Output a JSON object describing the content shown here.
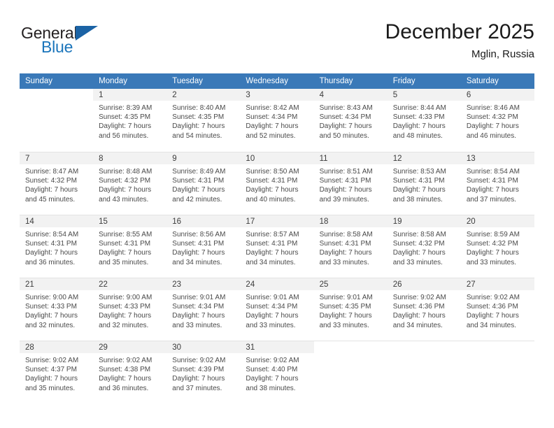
{
  "brand": {
    "name_top": "General",
    "name_bottom": "Blue",
    "triangle_icon": "triangle-icon",
    "color_dark": "#231f20",
    "color_blue": "#1b75bb"
  },
  "header": {
    "title": "December 2025",
    "subtitle": "Mglin, Russia"
  },
  "theme": {
    "header_row_bg": "#3a79b8",
    "daynum_band_bg": "#f2f2f2",
    "text_color": "#4a4a4a",
    "separator": "#e3e3e3"
  },
  "calendar": {
    "weekday_headers": [
      "Sunday",
      "Monday",
      "Tuesday",
      "Wednesday",
      "Thursday",
      "Friday",
      "Saturday"
    ],
    "weeks": [
      [
        {
          "day": "",
          "blank": true,
          "lines": []
        },
        {
          "day": "1",
          "lines": [
            "Sunrise: 8:39 AM",
            "Sunset: 4:35 PM",
            "Daylight: 7 hours",
            "and 56 minutes."
          ]
        },
        {
          "day": "2",
          "lines": [
            "Sunrise: 8:40 AM",
            "Sunset: 4:35 PM",
            "Daylight: 7 hours",
            "and 54 minutes."
          ]
        },
        {
          "day": "3",
          "lines": [
            "Sunrise: 8:42 AM",
            "Sunset: 4:34 PM",
            "Daylight: 7 hours",
            "and 52 minutes."
          ]
        },
        {
          "day": "4",
          "lines": [
            "Sunrise: 8:43 AM",
            "Sunset: 4:34 PM",
            "Daylight: 7 hours",
            "and 50 minutes."
          ]
        },
        {
          "day": "5",
          "lines": [
            "Sunrise: 8:44 AM",
            "Sunset: 4:33 PM",
            "Daylight: 7 hours",
            "and 48 minutes."
          ]
        },
        {
          "day": "6",
          "lines": [
            "Sunrise: 8:46 AM",
            "Sunset: 4:32 PM",
            "Daylight: 7 hours",
            "and 46 minutes."
          ]
        }
      ],
      [
        {
          "day": "7",
          "lines": [
            "Sunrise: 8:47 AM",
            "Sunset: 4:32 PM",
            "Daylight: 7 hours",
            "and 45 minutes."
          ]
        },
        {
          "day": "8",
          "lines": [
            "Sunrise: 8:48 AM",
            "Sunset: 4:32 PM",
            "Daylight: 7 hours",
            "and 43 minutes."
          ]
        },
        {
          "day": "9",
          "lines": [
            "Sunrise: 8:49 AM",
            "Sunset: 4:31 PM",
            "Daylight: 7 hours",
            "and 42 minutes."
          ]
        },
        {
          "day": "10",
          "lines": [
            "Sunrise: 8:50 AM",
            "Sunset: 4:31 PM",
            "Daylight: 7 hours",
            "and 40 minutes."
          ]
        },
        {
          "day": "11",
          "lines": [
            "Sunrise: 8:51 AM",
            "Sunset: 4:31 PM",
            "Daylight: 7 hours",
            "and 39 minutes."
          ]
        },
        {
          "day": "12",
          "lines": [
            "Sunrise: 8:53 AM",
            "Sunset: 4:31 PM",
            "Daylight: 7 hours",
            "and 38 minutes."
          ]
        },
        {
          "day": "13",
          "lines": [
            "Sunrise: 8:54 AM",
            "Sunset: 4:31 PM",
            "Daylight: 7 hours",
            "and 37 minutes."
          ]
        }
      ],
      [
        {
          "day": "14",
          "lines": [
            "Sunrise: 8:54 AM",
            "Sunset: 4:31 PM",
            "Daylight: 7 hours",
            "and 36 minutes."
          ]
        },
        {
          "day": "15",
          "lines": [
            "Sunrise: 8:55 AM",
            "Sunset: 4:31 PM",
            "Daylight: 7 hours",
            "and 35 minutes."
          ]
        },
        {
          "day": "16",
          "lines": [
            "Sunrise: 8:56 AM",
            "Sunset: 4:31 PM",
            "Daylight: 7 hours",
            "and 34 minutes."
          ]
        },
        {
          "day": "17",
          "lines": [
            "Sunrise: 8:57 AM",
            "Sunset: 4:31 PM",
            "Daylight: 7 hours",
            "and 34 minutes."
          ]
        },
        {
          "day": "18",
          "lines": [
            "Sunrise: 8:58 AM",
            "Sunset: 4:31 PM",
            "Daylight: 7 hours",
            "and 33 minutes."
          ]
        },
        {
          "day": "19",
          "lines": [
            "Sunrise: 8:58 AM",
            "Sunset: 4:32 PM",
            "Daylight: 7 hours",
            "and 33 minutes."
          ]
        },
        {
          "day": "20",
          "lines": [
            "Sunrise: 8:59 AM",
            "Sunset: 4:32 PM",
            "Daylight: 7 hours",
            "and 33 minutes."
          ]
        }
      ],
      [
        {
          "day": "21",
          "lines": [
            "Sunrise: 9:00 AM",
            "Sunset: 4:33 PM",
            "Daylight: 7 hours",
            "and 32 minutes."
          ]
        },
        {
          "day": "22",
          "lines": [
            "Sunrise: 9:00 AM",
            "Sunset: 4:33 PM",
            "Daylight: 7 hours",
            "and 32 minutes."
          ]
        },
        {
          "day": "23",
          "lines": [
            "Sunrise: 9:01 AM",
            "Sunset: 4:34 PM",
            "Daylight: 7 hours",
            "and 33 minutes."
          ]
        },
        {
          "day": "24",
          "lines": [
            "Sunrise: 9:01 AM",
            "Sunset: 4:34 PM",
            "Daylight: 7 hours",
            "and 33 minutes."
          ]
        },
        {
          "day": "25",
          "lines": [
            "Sunrise: 9:01 AM",
            "Sunset: 4:35 PM",
            "Daylight: 7 hours",
            "and 33 minutes."
          ]
        },
        {
          "day": "26",
          "lines": [
            "Sunrise: 9:02 AM",
            "Sunset: 4:36 PM",
            "Daylight: 7 hours",
            "and 34 minutes."
          ]
        },
        {
          "day": "27",
          "lines": [
            "Sunrise: 9:02 AM",
            "Sunset: 4:36 PM",
            "Daylight: 7 hours",
            "and 34 minutes."
          ]
        }
      ],
      [
        {
          "day": "28",
          "lines": [
            "Sunrise: 9:02 AM",
            "Sunset: 4:37 PM",
            "Daylight: 7 hours",
            "and 35 minutes."
          ]
        },
        {
          "day": "29",
          "lines": [
            "Sunrise: 9:02 AM",
            "Sunset: 4:38 PM",
            "Daylight: 7 hours",
            "and 36 minutes."
          ]
        },
        {
          "day": "30",
          "lines": [
            "Sunrise: 9:02 AM",
            "Sunset: 4:39 PM",
            "Daylight: 7 hours",
            "and 37 minutes."
          ]
        },
        {
          "day": "31",
          "lines": [
            "Sunrise: 9:02 AM",
            "Sunset: 4:40 PM",
            "Daylight: 7 hours",
            "and 38 minutes."
          ]
        },
        {
          "day": "",
          "blank": true,
          "lines": []
        },
        {
          "day": "",
          "blank": true,
          "lines": []
        },
        {
          "day": "",
          "blank": true,
          "lines": []
        }
      ]
    ]
  }
}
